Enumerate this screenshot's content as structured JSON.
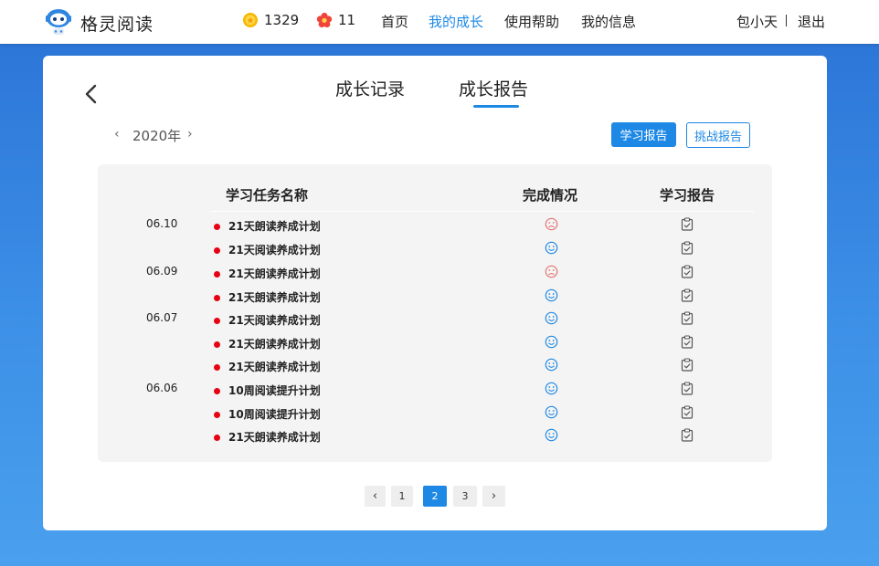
{
  "header": {
    "app_name": "格灵阅读",
    "coins": "1329",
    "flowers": "11",
    "nav": {
      "home": "首页",
      "growth": "我的成长",
      "help": "使用帮助",
      "info": "我的信息"
    },
    "user": "包小天",
    "logout": "退出"
  },
  "tabs": {
    "record": "成长记录",
    "report": "成长报告"
  },
  "year": "2020年",
  "buttons": {
    "study_report": "学习报告",
    "challenge_report": "挑战报告"
  },
  "table": {
    "headers": {
      "name": "学习任务名称",
      "status": "完成情况",
      "report": "学习报告"
    },
    "rows": [
      {
        "date": "06.10",
        "task": "21天朗读养成计划",
        "status": "sad"
      },
      {
        "date": "",
        "task": "21天阅读养成计划",
        "status": "happy"
      },
      {
        "date": "06.09",
        "task": "21天朗读养成计划",
        "status": "sad"
      },
      {
        "date": "",
        "task": "21天朗读养成计划",
        "status": "happy"
      },
      {
        "date": "06.07",
        "task": "21天阅读养成计划",
        "status": "happy"
      },
      {
        "date": "",
        "task": "21天朗读养成计划",
        "status": "happy"
      },
      {
        "date": "",
        "task": "21天朗读养成计划",
        "status": "happy"
      },
      {
        "date": "06.06",
        "task": "10周阅读提升计划",
        "status": "happy"
      },
      {
        "date": "",
        "task": "10周阅读提升计划",
        "status": "happy"
      },
      {
        "date": "",
        "task": "21天朗读养成计划",
        "status": "happy"
      }
    ]
  },
  "pagination": {
    "pages": [
      "1",
      "2",
      "3"
    ],
    "current": "2"
  },
  "colors": {
    "accent": "#1e88e5",
    "dot": "#e60012",
    "sad_face": "#e57373",
    "happy_face": "#1e88e5"
  }
}
